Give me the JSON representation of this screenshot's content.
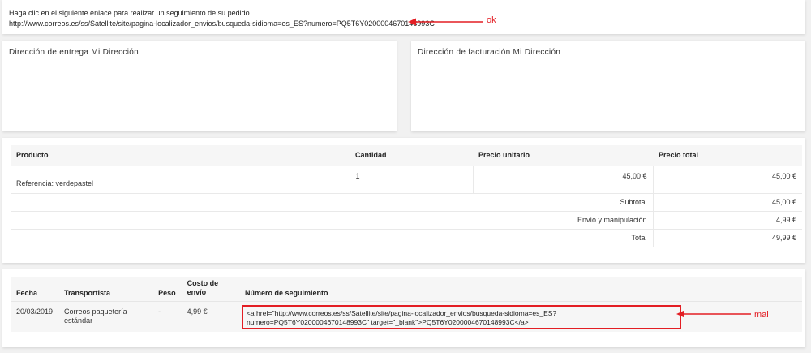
{
  "tracking": {
    "instruction": "Haga clic en el siguiente enlace para realizar un seguimiento de su pedido",
    "url": "http://www.correos.es/ss/Satellite/site/pagina-localizador_envios/busqueda-sidioma=es_ES?numero=PQ5T6Y0200004670148993C",
    "annotation_ok": "ok"
  },
  "addresses": {
    "delivery_title": "Dirección de entrega Mi Dirección",
    "billing_title": "Dirección de facturación Mi Dirección"
  },
  "products": {
    "headers": [
      "Producto",
      "Cantidad",
      "Precio unitario",
      "Precio total"
    ],
    "rows": [
      {
        "product": "Referencia: verdepastel",
        "quantity": "1",
        "unit_price": "45,00 €",
        "total": "45,00 €"
      }
    ],
    "summary": [
      {
        "label": "Subtotal",
        "value": "45,00 €"
      },
      {
        "label": "Envío y manipulación",
        "value": "4,99 €"
      },
      {
        "label": "Total",
        "value": "49,99 €"
      }
    ]
  },
  "shipping": {
    "headers": {
      "date": "Fecha",
      "carrier": "Transportista",
      "weight": "Peso",
      "cost": "Costo de envío",
      "tracking": "Número de seguimiento"
    },
    "row": {
      "date": "20/03/2019",
      "carrier": "Correos paquetería estándar",
      "weight": "-",
      "cost": "4,99 €",
      "tracking_raw": "<a href=\"http://www.correos.es/ss/Satellite/site/pagina-localizador_envios/busqueda-sidioma=es_ES?numero=PQ5T6Y0200004670148993C\" target=\"_blank\">PQ5T6Y0200004670148993C</a>"
    },
    "annotation_bad": "mal"
  },
  "colors": {
    "annotation": "#e31e24",
    "card": "#ffffff",
    "background": "#f1f1f1",
    "table_header": "#f6f6f6"
  }
}
